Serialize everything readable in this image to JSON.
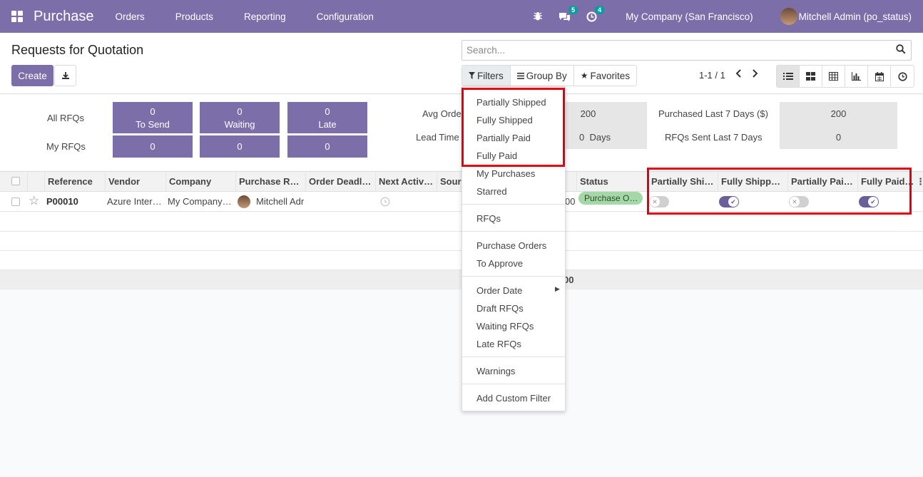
{
  "app": {
    "title": "Purchase",
    "menu": [
      "Orders",
      "Products",
      "Reporting",
      "Configuration"
    ],
    "messages_count": "5",
    "activities_count": "4",
    "company": "My Company (San Francisco)",
    "user": "Mitchell Admin (po_status)"
  },
  "control": {
    "page_title": "Requests for Quotation",
    "create_label": "Create",
    "search_placeholder": "Search...",
    "filters_label": "Filters",
    "groupby_label": "Group By",
    "favorites_label": "Favorites",
    "pager": "1-1 / 1"
  },
  "dashboard": {
    "all_rfqs_label": "All RFQs",
    "my_rfqs_label": "My RFQs",
    "tiles_all": [
      {
        "value": "0",
        "label": "To Send"
      },
      {
        "value": "0",
        "label": "Waiting"
      },
      {
        "value": "0",
        "label": "Late"
      }
    ],
    "tiles_my": [
      "0",
      "0",
      "0"
    ],
    "avg_order_label": "Avg Orde",
    "avg_order_value": "200",
    "lead_time_label": "Lead Time",
    "lead_time_value": "0  Days",
    "purchased_label": "Purchased Last 7 Days ($)",
    "purchased_value": "200",
    "rfqs_sent_label": "RFQs Sent Last 7 Days",
    "rfqs_sent_value": "0"
  },
  "table": {
    "headers": [
      "Reference",
      "Vendor",
      "Company",
      "Purchase R…",
      "Order Deadl…",
      "Next Activ…",
      "Sour",
      "Status",
      "Partially Shi…",
      "Fully Shipp…",
      "Partially Pai…",
      "Fully Paid…"
    ],
    "row": {
      "reference": "P00010",
      "vendor": "Azure Inter…",
      "company": "My Company…",
      "purchase_rep": "Mitchell Adr",
      "total_fragment": "00",
      "status": "Purchase O…",
      "partially_shipped": false,
      "fully_shipped": true,
      "partially_paid": false,
      "fully_paid": true
    },
    "footer_total": "00"
  },
  "filters_menu": {
    "custom": [
      "Partially Shipped",
      "Fully Shipped",
      "Partially Paid",
      "Fully Paid"
    ],
    "group1": [
      "My Purchases",
      "Starred"
    ],
    "group2": [
      "RFQs"
    ],
    "group3": [
      "Purchase Orders",
      "To Approve"
    ],
    "group4": [
      "Order Date",
      "Draft RFQs",
      "Waiting RFQs",
      "Late RFQs"
    ],
    "group5": [
      "Warnings"
    ],
    "group6": [
      "Add Custom Filter"
    ]
  },
  "colors": {
    "brand": "#7c6ea8",
    "highlight": "#e00010",
    "status_green": "#a4d8a7"
  }
}
